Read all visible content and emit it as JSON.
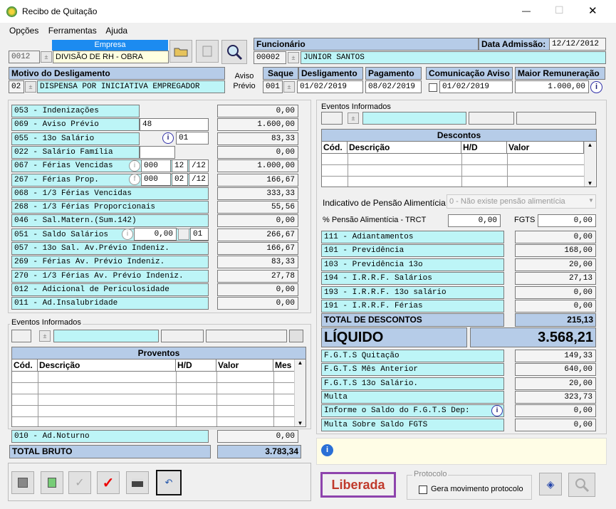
{
  "window": {
    "title": "Recibo de Quitação",
    "minimize": "—",
    "maximize": "☐",
    "close": "✕"
  },
  "menu": [
    "Opções",
    "Ferramentas",
    "Ajuda"
  ],
  "empresa": {
    "label": "Empresa",
    "code": "0012",
    "name": "DIVISÃO DE RH - OBRA"
  },
  "funcionario": {
    "label": "Funcionário",
    "code": "00002",
    "name": "JUNIOR SANTOS",
    "data_admissao_label": "Data Admissão:",
    "data_admissao": "12/12/2012"
  },
  "motivo": {
    "label": "Motivo do Desligamento",
    "code": "02",
    "name": "DISPENSA POR INICIATIVA EMPREGADOR",
    "aviso_label1": "Aviso",
    "aviso_label2": "Prévio"
  },
  "saque": {
    "label": "Saque",
    "code": "001"
  },
  "desligamento": {
    "label": "Desligamento",
    "date": "01/02/2019"
  },
  "pagamento": {
    "label": "Pagamento",
    "date": "08/02/2019"
  },
  "comunicacao": {
    "label": "Comunicação Aviso",
    "date": "01/02/2019"
  },
  "maior_remuneracao": {
    "label": "Maior Remuneração",
    "value": "1.000,00"
  },
  "proventos_rows": [
    {
      "label": "053 - Indenizações",
      "value": "0,00"
    },
    {
      "label": "069 - Aviso Prévio",
      "extra": "48",
      "value": "1.600,00"
    },
    {
      "label": "055 - 13o Salário",
      "extra": "01",
      "value": "83,33"
    },
    {
      "label": "022 - Salário Família",
      "value": "0,00"
    },
    {
      "label": "067 - Férias Vencidas",
      "extra": "000",
      "extra2": "12",
      "extra3": "/12",
      "value": "1.000,00"
    },
    {
      "label": "267 - Férias Prop.",
      "extra": "000",
      "extra2": "02",
      "extra3": "/12",
      "value": "166,67"
    },
    {
      "label": "068 - 1/3 Férias Vencidas",
      "value": "333,33"
    },
    {
      "label": "268 - 1/3 Férias Proporcionais",
      "value": "55,56"
    },
    {
      "label": "046 - Sal.Matern.(Sum.142)",
      "value": "0,00"
    },
    {
      "label": "051 - Saldo Salários",
      "extra": "0,00",
      "extra2": "01",
      "value": "266,67"
    },
    {
      "label": "057 - 13o Sal. Av.Prévio Indeniz.",
      "value": "166,67"
    },
    {
      "label": "269 - Férias Av. Prévio Indeniz.",
      "value": "83,33"
    },
    {
      "label": "270 - 1/3 Férias Av. Prévio Indeniz.",
      "value": "27,78"
    },
    {
      "label": "012 - Adicional de Periculosidade",
      "value": "0,00"
    },
    {
      "label": "011 - Ad.Insalubridade",
      "value": "0,00"
    }
  ],
  "eventos_left": {
    "label": "Eventos Informados",
    "grid_title": "Proventos",
    "cols": [
      "Cód.",
      "Descrição",
      "H/D",
      "Valor",
      "Mes"
    ]
  },
  "ad_noturno": {
    "label": "010 - Ad.Noturno",
    "value": "0,00"
  },
  "total_bruto": {
    "label": "TOTAL BRUTO",
    "value": "3.783,34"
  },
  "eventos_right": {
    "label": "Eventos Informados",
    "grid_title": "Descontos",
    "cols": [
      "Cód.",
      "Descrição",
      "H/D",
      "Valor"
    ]
  },
  "pensao": {
    "label": "Indicativo de Pensão Alimentícia",
    "selected": "0 - Não existe pensão alimentícia",
    "pct_label": "% Pensão Alimentícia - TRCT",
    "pct": "0,00",
    "fgts_label": "FGTS",
    "fgts": "0,00"
  },
  "descontos_rows": [
    {
      "label": "111 - Adiantamentos",
      "value": "0,00"
    },
    {
      "label": "101 - Previdência",
      "value": "168,00"
    },
    {
      "label": "103 - Previdência 13o",
      "value": "20,00"
    },
    {
      "label": "194 - I.R.R.F. Salários",
      "value": "27,13"
    },
    {
      "label": "193 - I.R.R.F. 13o salário",
      "value": "0,00"
    },
    {
      "label": "191 - I.R.R.F. Férias",
      "value": "0,00"
    }
  ],
  "total_descontos": {
    "label": "TOTAL DE DESCONTOS",
    "value": "215,13"
  },
  "liquido": {
    "label": "LÍQUIDO",
    "value": "3.568,21"
  },
  "fgts_rows": [
    {
      "label": "F.G.T.S  Quitação",
      "value": "149,33"
    },
    {
      "label": "F.G.T.S  Mês Anterior",
      "value": "640,00"
    },
    {
      "label": "F.G.T.S  13o Salário.",
      "value": "20,00"
    },
    {
      "label": "Multa",
      "value": "323,73"
    },
    {
      "label": "Informe o Saldo do F.G.T.S Dep:",
      "value": "0,00"
    },
    {
      "label": "Multa Sobre Saldo FGTS",
      "value": "0,00"
    }
  ],
  "status": {
    "label": "Liberada",
    "color": "#c0392b",
    "border": "#8e44ad"
  },
  "protocolo": {
    "label": "Protocolo",
    "checkbox": "Gera movimento protocolo"
  }
}
